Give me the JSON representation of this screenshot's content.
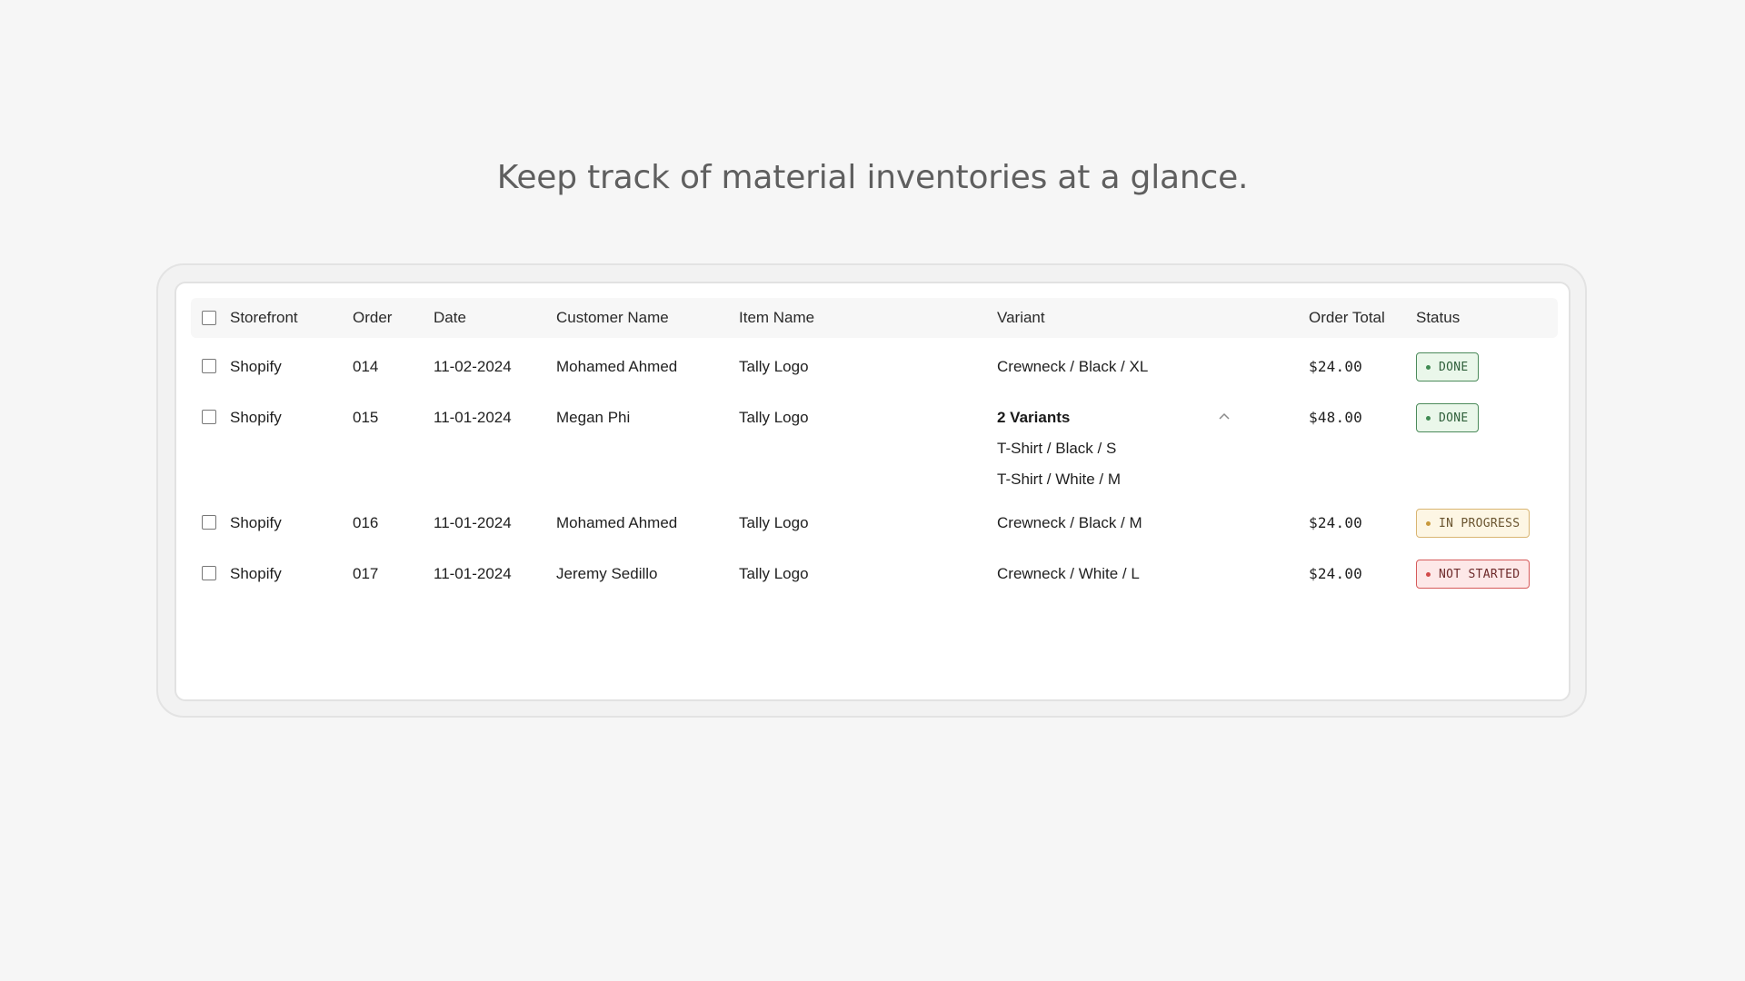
{
  "headline": "Keep track of material inventories at a glance.",
  "table": {
    "headers": {
      "storefront": "Storefront",
      "order": "Order",
      "date": "Date",
      "customer": "Customer Name",
      "item": "Item Name",
      "variant": "Variant",
      "total": "Order Total",
      "status": "Status"
    },
    "rows": [
      {
        "storefront": "Shopify",
        "order": "014",
        "date": "11-02-2024",
        "customer": "Mohamed Ahmed",
        "item": "Tally Logo",
        "variant": "Crewneck / Black / XL",
        "total": "$24.00",
        "status": "DONE",
        "status_color": "#3f8a52"
      },
      {
        "storefront": "Shopify",
        "order": "015",
        "date": "11-01-2024",
        "customer": "Megan Phi",
        "item": "Tally Logo",
        "variant": "2 Variants",
        "variant_icon": "chevron-up-icon",
        "sub_variants": [
          "T-Shirt / Black / S",
          "T-Shirt / White / M"
        ],
        "total": "$48.00",
        "status": "DONE",
        "status_color": "#3f8a52"
      },
      {
        "storefront": "Shopify",
        "order": "016",
        "date": "11-01-2024",
        "customer": "Mohamed Ahmed",
        "item": "Tally Logo",
        "variant": "Crewneck / Black / M",
        "total": "$24.00",
        "status": "IN PROGRESS",
        "status_color": "#c8993c"
      },
      {
        "storefront": "Shopify",
        "order": "017",
        "date": "11-01-2024",
        "customer": "Jeremy Sedillo",
        "item": "Tally Logo",
        "variant": "Crewneck / White / L",
        "total": "$24.00",
        "status": "NOT STARTED",
        "status_color": "#d14a4a"
      }
    ]
  }
}
